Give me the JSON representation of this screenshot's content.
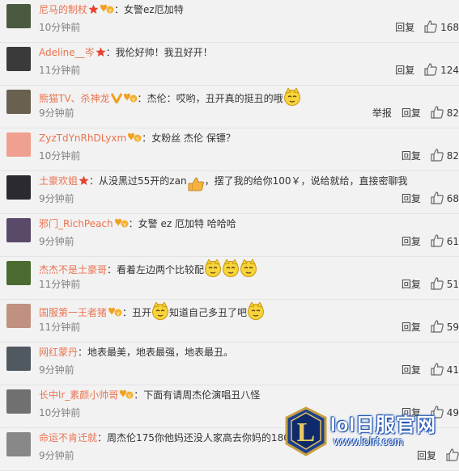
{
  "comments": [
    {
      "username": "尼马的制杖",
      "badges": [
        "star",
        "vip"
      ],
      "text": "女警ez厄加特",
      "time": "10分钟前",
      "reply": "回复",
      "report": "",
      "likes": "168",
      "faces": 0,
      "avatar_color": "#4a5a40"
    },
    {
      "username": "Adeline__岑",
      "badges": [
        "star"
      ],
      "text": "我伦好帅！我丑好开！",
      "time": "11分钟前",
      "reply": "回复",
      "report": "",
      "likes": "124",
      "faces": 0,
      "avatar_color": "#3a3a3a"
    },
    {
      "username": "熊猫TV、杀神龙",
      "badges": [
        "v",
        "vip"
      ],
      "text": "杰伦：哎哟，丑开真的挺丑的哦",
      "time": "9分钟前",
      "reply": "回复",
      "report": "举报",
      "likes": "82",
      "faces": 1,
      "avatar_color": "#6a6050"
    },
    {
      "username": "ZyzTdYnRhDLyxm",
      "badges": [
        "vip"
      ],
      "text": "女粉丝 杰伦 保镖？",
      "time": "10分钟前",
      "reply": "回复",
      "report": "",
      "likes": "82",
      "faces": 0,
      "avatar_color": "#f0a090"
    },
    {
      "username": "土豪欢姐",
      "badges": [
        "star"
      ],
      "text": "从没黑过55开的zan",
      "text_after": "，摆了我的给你100￥，说给就给，直接密聊我",
      "time": "9分钟前",
      "reply": "回复",
      "report": "",
      "likes": "68",
      "faces": 0,
      "avatar_color": "#2a2a30"
    },
    {
      "username": "邪门_RichPeach",
      "badges": [
        "vip"
      ],
      "text": "女警   ez  厄加特 哈哈哈",
      "time": "9分钟前",
      "reply": "回复",
      "report": "",
      "likes": "61",
      "faces": 0,
      "avatar_color": "#5a4a6a"
    },
    {
      "username": "杰杰不是土豪哥",
      "badges": [],
      "text": "看着左边两个比较配",
      "time": "11分钟前",
      "reply": "回复",
      "report": "",
      "likes": "51",
      "faces": 3,
      "avatar_color": "#4a6a30"
    },
    {
      "username": "国服第一王者猪",
      "badges": [
        "vip"
      ],
      "text": "丑开",
      "text_after": "知道自己多丑了吧",
      "time": "11分钟前",
      "reply": "回复",
      "report": "",
      "likes": "59",
      "faces": 2,
      "avatar_color": "#c09080"
    },
    {
      "username": "网红蒙丹",
      "badges": [],
      "text": "地表最美，地表最强，地表最丑。",
      "time": "9分钟前",
      "reply": "回复",
      "report": "",
      "likes": "41",
      "faces": 0,
      "avatar_color": "#505860"
    },
    {
      "username": "长中lr_素颜小帅哥",
      "badges": [
        "vip"
      ],
      "text": "下面有请周杰伦演唱丑八怪",
      "time": "10分钟前",
      "reply": "回复",
      "report": "",
      "likes": "49",
      "faces": 0,
      "avatar_color": "#707070"
    },
    {
      "username": "命运不肯迁就",
      "badges": [],
      "text": "周杰伦175你他妈还没人家高去你妈的180",
      "time": "9分钟前",
      "reply": "回复",
      "report": "",
      "likes": "",
      "faces": 0,
      "avatar_color": "#888888"
    }
  ],
  "watermark": {
    "title": "lol日服官网",
    "url": "www.lolrf.com",
    "logo_letter": "L"
  },
  "colors": {
    "username": "#eb7350",
    "time": "#808080",
    "background": "#f2f2f2"
  }
}
